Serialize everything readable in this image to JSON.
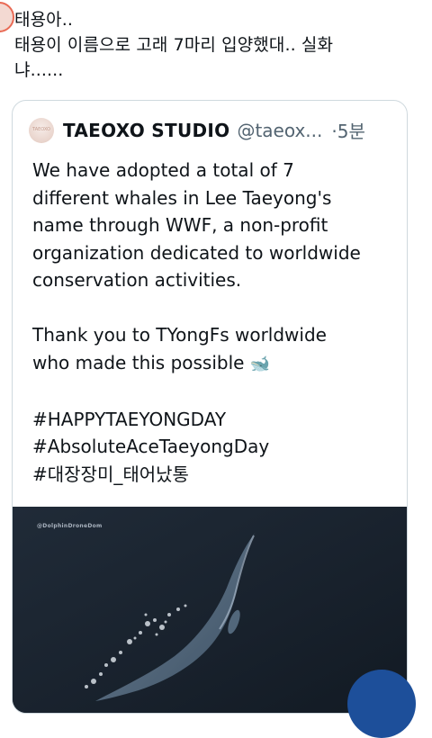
{
  "tweet": {
    "lines": [
      "태용아..",
      "태용이 이름으로 고래 7마리 입양했대.. 실화",
      "냐......"
    ]
  },
  "quote": {
    "display_name": "TAEOXO STUDIO",
    "handle": "@taeox...",
    "time": "·5분",
    "avatar_text": "TAEOXO",
    "body_lines": [
      "We have adopted a total of 7",
      "different whales in Lee Taeyong's",
      "name through WWF, a non-profit",
      "organization dedicated to worldwide",
      "conservation activities.",
      "",
      "Thank you to TYongFs worldwide",
      "who made this possible",
      "",
      "#HAPPYTAEYONGDAY",
      "#AbsoluteAceTaeyongDay",
      "#대장장미_태어났통"
    ],
    "emoji": "🐋",
    "media_watermark": "@DolphinDroneDom"
  },
  "colors": {
    "text": "#0f1419",
    "secondary": "#536471",
    "border": "#cfd9de",
    "media_bg": "#1b2430",
    "fab": "#1d4f9a"
  }
}
